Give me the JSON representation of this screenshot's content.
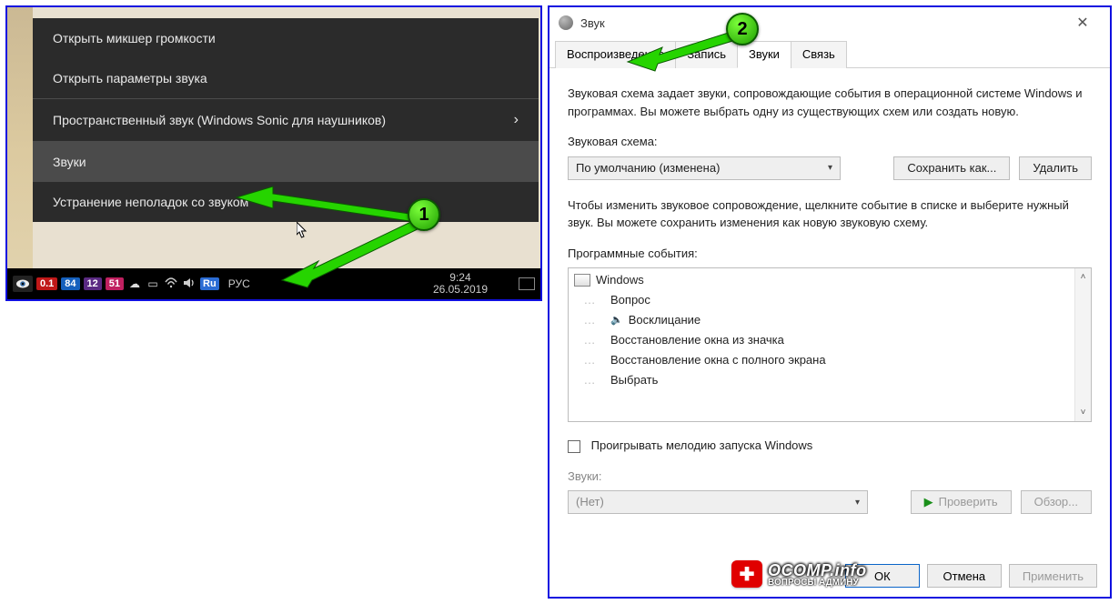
{
  "annotations": {
    "badge1": "1",
    "badge2": "2"
  },
  "context_menu": {
    "open_mixer": "Открыть микшер громкости",
    "open_sound_settings": "Открыть параметры звука",
    "spatial_sound": "Пространственный звук (Windows Sonic для наушников)",
    "sounds": "Звуки",
    "troubleshoot": "Устранение неполадок со звуком"
  },
  "taskbar": {
    "stat_red": "0.1",
    "stat_blue": "84",
    "stat_purple": "12",
    "stat_pink": "51",
    "ru_badge": "Ru",
    "lang": "РУС",
    "time": "9:24",
    "date": "26.05.2019"
  },
  "dialog": {
    "title": "Звук",
    "tabs": {
      "playback": "Воспроизведение",
      "recording": "Запись",
      "sounds": "Звуки",
      "communications": "Связь"
    },
    "scheme_desc": "Звуковая схема задает звуки, сопровождающие события в операционной системе Windows и программах. Вы можете выбрать одну из существующих схем или создать новую.",
    "scheme_label": "Звуковая схема:",
    "scheme_value": "По умолчанию (изменена)",
    "save_as": "Сохранить как...",
    "delete": "Удалить",
    "events_desc": "Чтобы изменить звуковое сопровождение, щелкните событие в списке и выберите нужный звук. Вы можете сохранить изменения как новую звуковую схему.",
    "events_label": "Программные события:",
    "events_root": "Windows",
    "events": {
      "e0": "Вопрос",
      "e1": "Восклицание",
      "e2": "Восстановление окна из значка",
      "e3": "Восстановление окна с полного экрана",
      "e4": "Выбрать"
    },
    "play_startup": "Проигрывать мелодию запуска Windows",
    "sounds_label": "Звуки:",
    "sounds_value": "(Нет)",
    "test": "Проверить",
    "browse": "Обзор...",
    "ok": "ОК",
    "cancel": "Отмена",
    "apply": "Применить"
  },
  "watermark": {
    "site": "OCOMP.info",
    "tagline": "ВОПРОСЫ АДМИНУ"
  }
}
